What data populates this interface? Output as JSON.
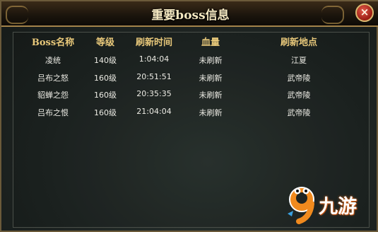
{
  "dialog": {
    "title": "重要boss信息",
    "close_glyph": "×"
  },
  "table": {
    "headers": [
      "Boss名称",
      "等级",
      "刷新时间",
      "血量",
      "刷新地点"
    ],
    "rows": [
      [
        "凌统",
        "140级",
        "1:04:04",
        "未刷新",
        "江夏"
      ],
      [
        "吕布之怒",
        "160级",
        "20:51:51",
        "未刷新",
        "武帝陵"
      ],
      [
        "貂蝉之怨",
        "160级",
        "20:35:35",
        "未刷新",
        "武帝陵"
      ],
      [
        "吕布之恨",
        "160级",
        "21:04:04",
        "未刷新",
        "武帝陵"
      ]
    ]
  },
  "watermark": {
    "digit": "9",
    "text": "九游",
    "icon": "9game-mascot-icon"
  },
  "colors": {
    "header_text": "#e8c87a",
    "cell_text": "#ecebe4",
    "title_text": "#f3e7c0",
    "frame_gold": "#a3834a",
    "close_red": "#9a1c12"
  }
}
